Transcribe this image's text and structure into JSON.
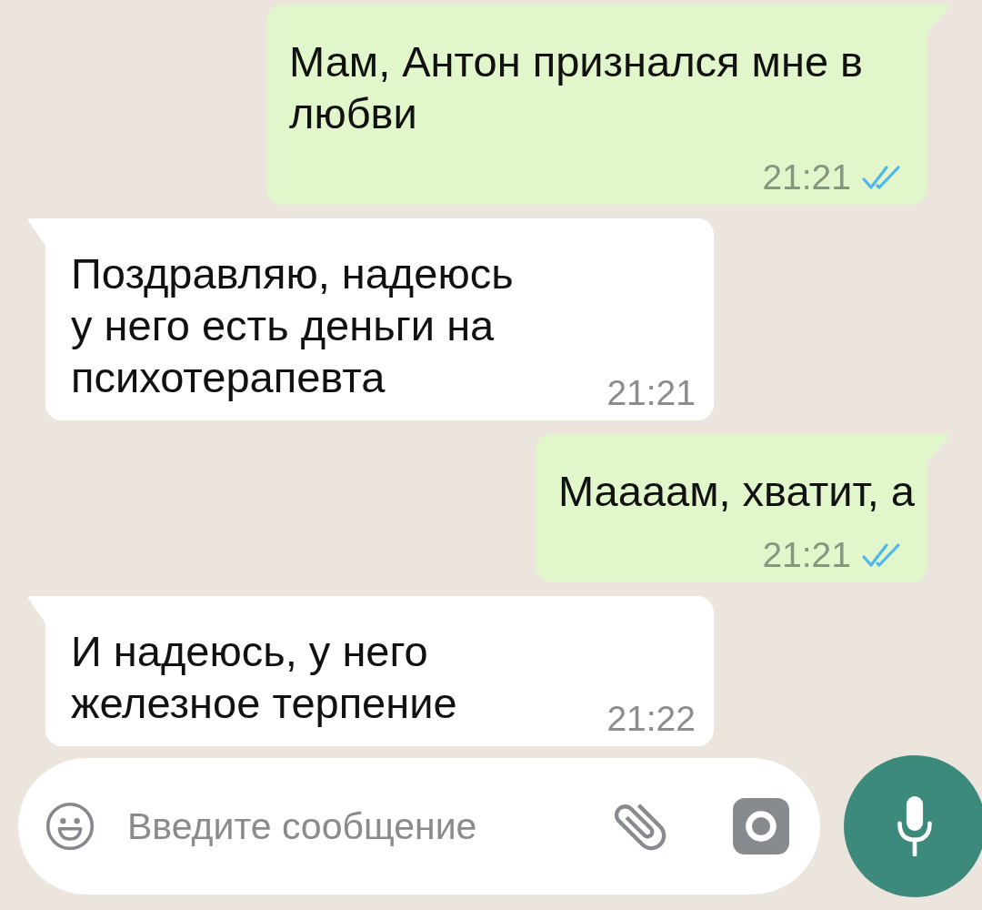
{
  "messages": [
    {
      "kind": "outgoing",
      "text": "Мам, Антон признался мне в любви",
      "time": "21:21",
      "read": true
    },
    {
      "kind": "incoming",
      "text": "Поздравляю, надеюсь у него есть деньги на психотерапевта",
      "time": "21:21"
    },
    {
      "kind": "outgoing",
      "text": "Маааам, хватит, а",
      "time": "21:21",
      "read": true
    },
    {
      "kind": "incoming",
      "text": "И надеюсь, у него железное терпение",
      "time": "21:22"
    }
  ],
  "composer": {
    "placeholder": "Введите сообщение"
  }
}
